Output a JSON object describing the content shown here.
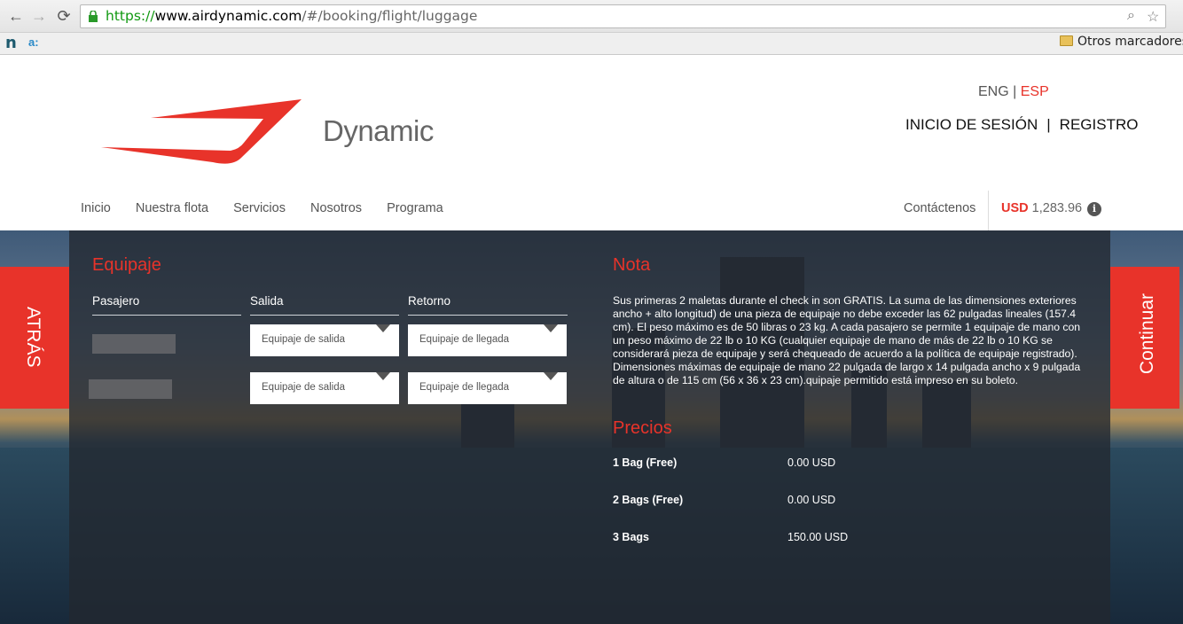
{
  "browser": {
    "url_scheme": "https://",
    "url_host": "www.airdynamic.com",
    "url_path": "/#/booking/flight/luggage",
    "bookmark_other": "Otros marcadores"
  },
  "header": {
    "lang_eng": "ENG",
    "lang_sep": "|",
    "lang_esp": "ESP",
    "login": "INICIO DE SESIÓN",
    "auth_sep": "|",
    "register": "REGISTRO",
    "logo_text": "Dynamic"
  },
  "nav": {
    "items": [
      "Inicio",
      "Nuestra flota",
      "Servicios",
      "Nosotros",
      "Programa"
    ],
    "contact": "Contáctenos",
    "currency": "USD",
    "total": "1,283.96",
    "info_glyph": "i"
  },
  "colors": {
    "accent": "#e8332a",
    "panel": "#222830"
  },
  "side": {
    "back": "ATRÁS",
    "continue": "Continuar"
  },
  "luggage": {
    "title": "Equipaje",
    "col_passenger": "Pasajero",
    "col_departure": "Salida",
    "col_return": "Retorno",
    "rows": [
      {
        "departure": "Equipaje de salida",
        "return": "Equipaje de llegada"
      },
      {
        "departure": "Equipaje de salida",
        "return": "Equipaje de llegada"
      }
    ]
  },
  "note": {
    "title": "Nota",
    "text": "Sus primeras 2 maletas durante el check in son GRATIS. La suma de las dimensiones exteriores ancho + alto longitud) de una pieza de equipaje no debe exceder las 62 pulgadas lineales (157.4 cm). El peso máximo es de 50 libras o 23 kg. A cada pasajero se permite 1 equipaje de mano con un peso máximo de 22 lb o 10 KG (cualquier equipaje de mano de más de 22 lb o 10 KG se considerará pieza de equipaje y será chequeado de acuerdo a la política de equipaje registrado). Dimensiones máximas de equipaje de mano 22 pulgada de largo x 14 pulgada ancho x 9 pulgada de altura o de 115 cm (56 x 36 x 23 cm).quipaje permitido está impreso en su boleto."
  },
  "prices": {
    "title": "Precios",
    "rows": [
      {
        "label": "1 Bag (Free)",
        "value": "0.00 USD"
      },
      {
        "label": "2 Bags (Free)",
        "value": "0.00 USD"
      },
      {
        "label": "3 Bags",
        "value": "150.00 USD"
      }
    ]
  }
}
